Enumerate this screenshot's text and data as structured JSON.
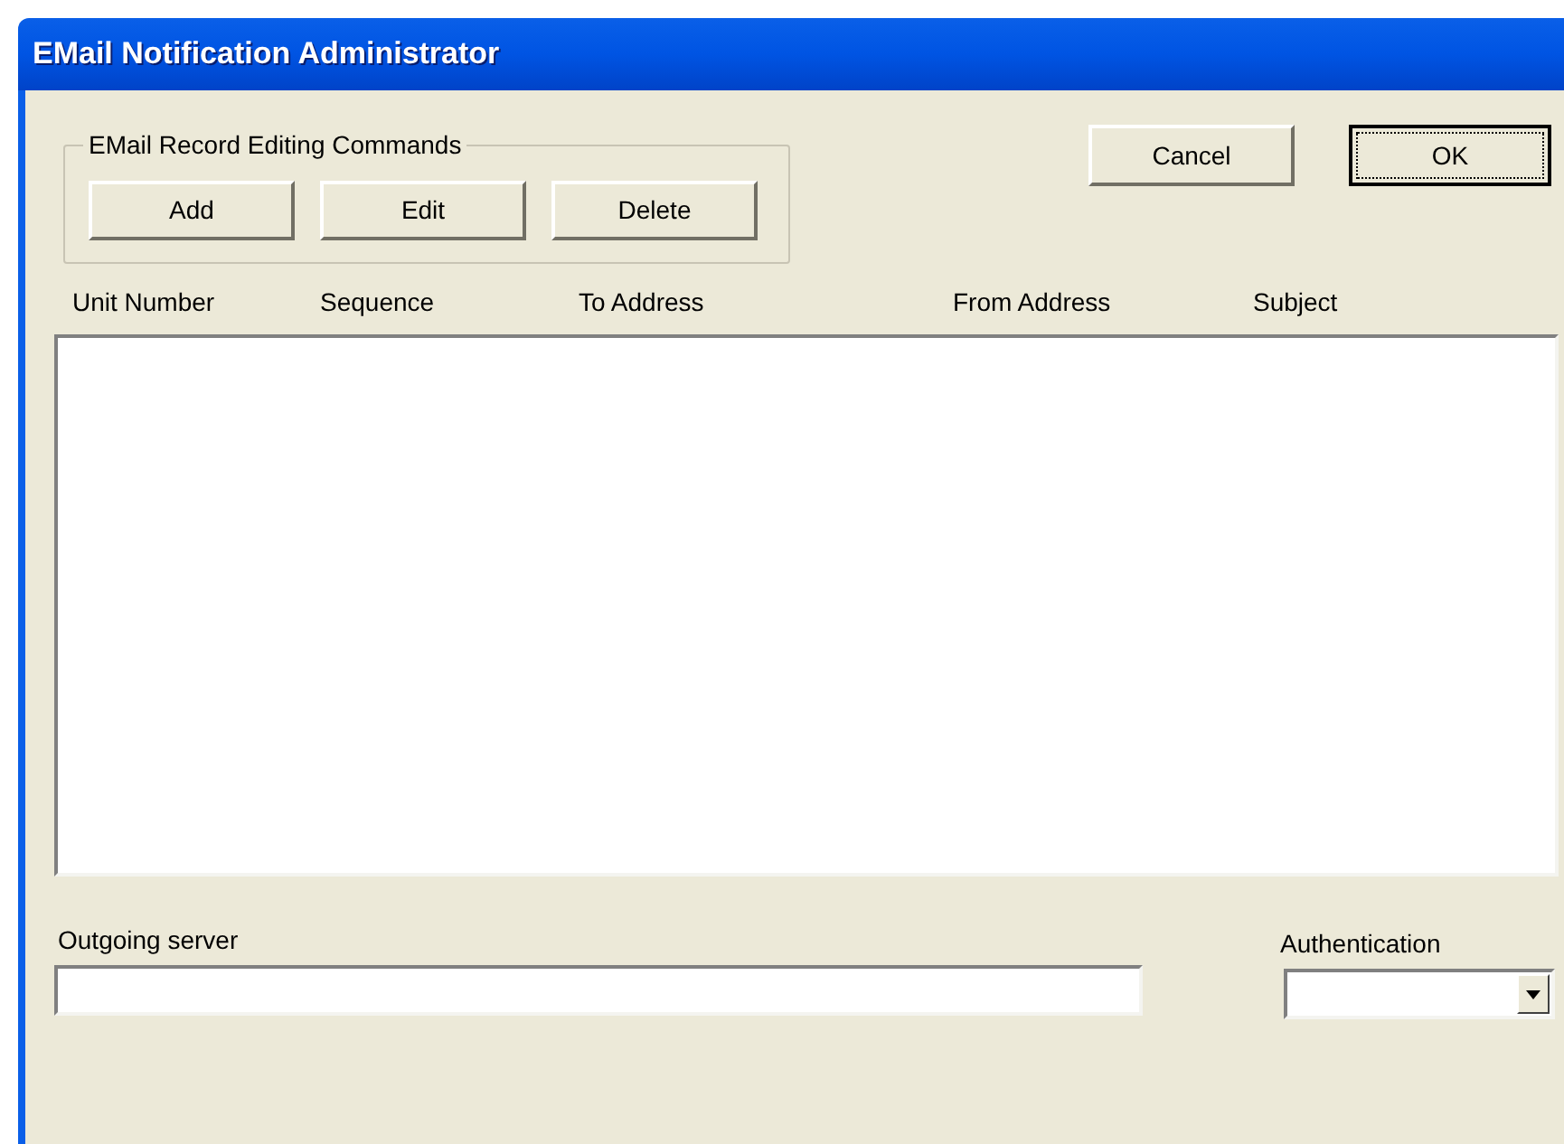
{
  "window": {
    "title": "EMail Notification Administrator"
  },
  "record_commands": {
    "title": "EMail Record Editing Commands",
    "buttons": [
      "Add",
      "Edit",
      "Delete"
    ]
  },
  "dialog_buttons": [
    {
      "label": "Cancel",
      "focused": false
    },
    {
      "label": "OK",
      "focused": true
    }
  ],
  "table": {
    "columns": [
      "Unit Number",
      "Sequence",
      "To Address",
      "From Address",
      "Subject"
    ]
  },
  "outgoing_server": {
    "label": "Outgoing server"
  },
  "authentication": {
    "label": "Authentication"
  }
}
